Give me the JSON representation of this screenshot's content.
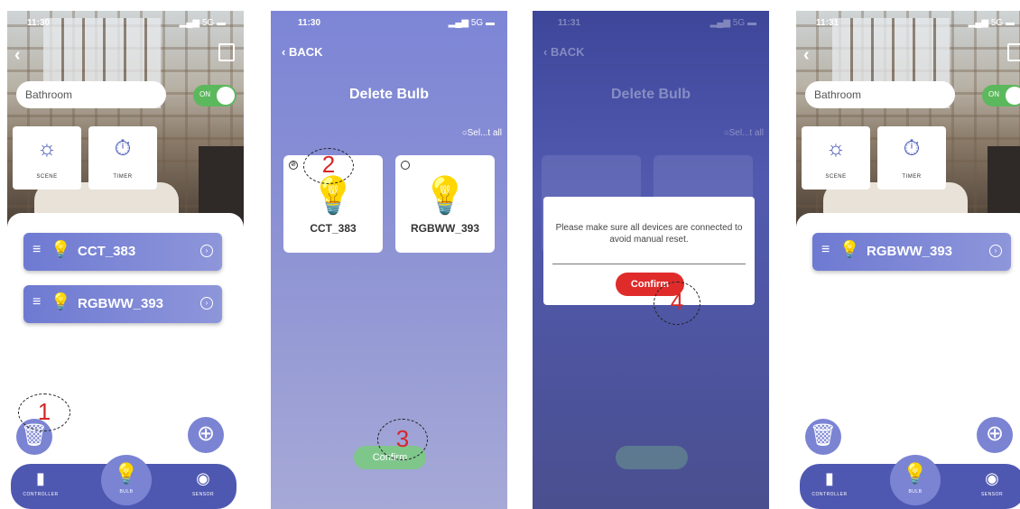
{
  "screens": {
    "home1": {
      "status_time": "11:30",
      "status_signal": "5G",
      "room_name": "Bathroom",
      "toggle_label": "ON",
      "tiles": [
        {
          "label": "SCENE",
          "icon": "sun-moon-icon"
        },
        {
          "label": "TIMER",
          "icon": "stopwatch-icon"
        }
      ],
      "bulbs": [
        {
          "name": "CCT_383",
          "icon": "bulb-outline-icon"
        },
        {
          "name": "RGBWW_393",
          "icon": "rgb-bulb-icon"
        }
      ],
      "nav": [
        "CONTROLLER",
        "BULB",
        "SENSOR"
      ],
      "marker": "1"
    },
    "delete": {
      "status_time": "11:30",
      "status_signal": "5G",
      "back_label": "BACK",
      "title": "Delete Bulb",
      "select_all": "Sel...t all",
      "cards": [
        {
          "name": "CCT_383",
          "icon": "bulb-outline-icon"
        },
        {
          "name": "RGBWW_393",
          "icon": "rgb-bulb-icon"
        }
      ],
      "confirm_label": "Confirm",
      "marker_card": "2",
      "marker_confirm": "3"
    },
    "dialog": {
      "status_time": "11:31",
      "status_signal": "5G",
      "back_label": "BACK",
      "title": "Delete Bulb",
      "select_all": "Sel...t all",
      "message": "Please make sure all devices are connected to avoid manual reset.",
      "confirm_label": "Confirm",
      "marker": "4"
    },
    "home2": {
      "status_time": "11:31",
      "status_signal": "5G",
      "room_name": "Bathroom",
      "toggle_label": "ON",
      "tiles": [
        {
          "label": "SCENE",
          "icon": "sun-moon-icon"
        },
        {
          "label": "TIMER",
          "icon": "stopwatch-icon"
        }
      ],
      "bulbs": [
        {
          "name": "RGBWW_393",
          "icon": "rgb-bulb-icon"
        }
      ],
      "nav": [
        "CONTROLLER",
        "BULB",
        "SENSOR"
      ]
    }
  },
  "colors": {
    "brand_purple": "#6e7ad2",
    "toggle_green": "#5cb85c",
    "confirm_red": "#e02b2b",
    "confirm_green": "#7fc68a",
    "marker_red": "#d62828"
  }
}
